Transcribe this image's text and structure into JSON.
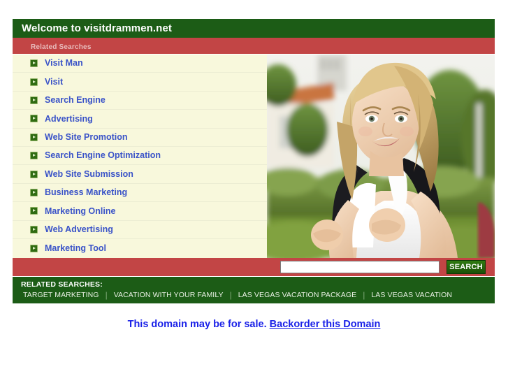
{
  "page": {
    "title": "Welcome to visitdrammen.net",
    "subheader": "Related Searches"
  },
  "search_list": {
    "items": [
      {
        "label": "Visit Man"
      },
      {
        "label": "Visit"
      },
      {
        "label": "Search Engine"
      },
      {
        "label": "Advertising"
      },
      {
        "label": "Web Site Promotion"
      },
      {
        "label": "Search Engine Optimization"
      },
      {
        "label": "Web Site Submission"
      },
      {
        "label": "Business Marketing"
      },
      {
        "label": "Marketing Online"
      },
      {
        "label": "Web Advertising"
      },
      {
        "label": "Marketing Tool"
      }
    ],
    "bullet_icon": "green-arrow-bullet-icon"
  },
  "photo": {
    "alt": "Smiling blonde young woman wearing a backpack outdoors in front of a building with a terracotta roof and green hedges"
  },
  "search": {
    "value": "",
    "placeholder": "",
    "button_label": "SEARCH"
  },
  "related": {
    "title": "RELATED SEARCHES:",
    "separator": "|",
    "links": [
      "TARGET MARKETING",
      "VACATION WITH YOUR FAMILY",
      "LAS VEGAS VACATION PACKAGE",
      "LAS VEGAS VACATION"
    ]
  },
  "sale": {
    "text": "This domain may be for sale.",
    "link_label": "Backorder this Domain"
  },
  "colors": {
    "green_dark": "#1c5c16",
    "red": "#c24545",
    "cream": "#f8f8dc",
    "link_blue": "#3a53c8",
    "sale_blue": "#1a21e8",
    "button_green": "#2f7a12"
  }
}
